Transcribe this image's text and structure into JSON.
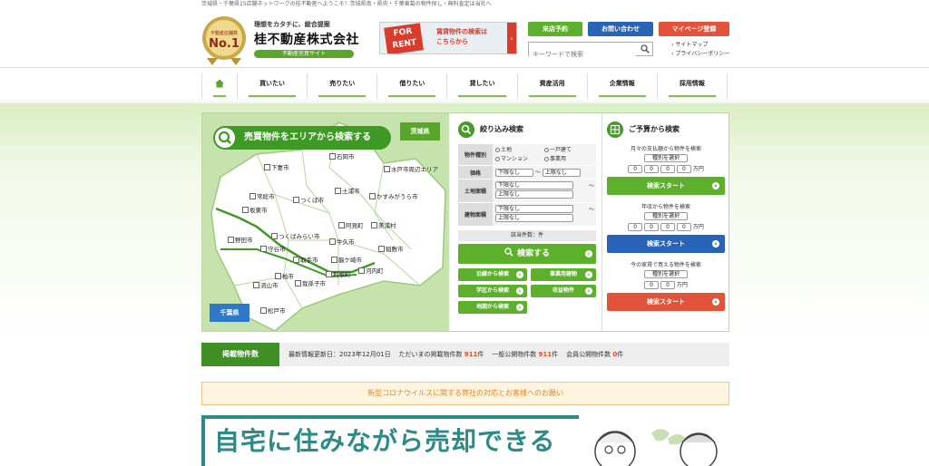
{
  "top_strip": "茨城県・千葉県15店舗ネットワークの桂不動産へようこそ！茨城県南・県央・千葉東葛の物件探し・無料査定は当社へ",
  "logo": {
    "tagline": "理想をカタチに、総合提案",
    "name": "桂不動産株式会社",
    "site": "不動産売買サイト",
    "badge": "No.1"
  },
  "rent_banner": {
    "sign": "FOR RENT",
    "line1": "賃貸物件の検索は",
    "line2": "こちらから"
  },
  "header_buttons": {
    "visit": "来店予約",
    "contact": "お問い合わせ",
    "mypage": "マイページ登録"
  },
  "search": {
    "placeholder": "キーワードで検索"
  },
  "header_links": {
    "sitemap": "サイトマップ",
    "privacy": "プライバシーポリシー"
  },
  "nav": [
    "買いたい",
    "売りたい",
    "借りたい",
    "貸したい",
    "資産活用",
    "企業情報",
    "採用情報"
  ],
  "map": {
    "title": "売買物件をエリアから検索する",
    "pref_ibaraki": "茨城県",
    "pref_chiba": "千葉県",
    "cities": [
      "石岡市",
      "下妻市",
      "水戸市周辺エリア",
      "常総市",
      "つくば市",
      "土浦市",
      "かすみがうら市",
      "坂東市",
      "阿見町",
      "美浦村",
      "野田市",
      "つくばみらい市",
      "牛久市",
      "稲敷市",
      "守谷市",
      "取手市",
      "龍ケ崎市",
      "河内町",
      "柏市",
      "利根町",
      "流山市",
      "我孫子市",
      "松戸市"
    ]
  },
  "filter": {
    "title": "絞り込み検索",
    "type_label": "物件種別",
    "types": [
      "土地",
      "一戸建て",
      "マンション",
      "事業用"
    ],
    "price_label": "価格",
    "land_label": "土地面積",
    "building_label": "建物面積",
    "lower": "下限なし",
    "upper": "上限なし",
    "tilde": "～",
    "count_label": "該当件数：件",
    "search_btn": "検索する",
    "sub_buttons": [
      "沿線から検索",
      "事業用建物",
      "学区から検索",
      "収益物件",
      "地図から検索"
    ]
  },
  "budget": {
    "title": "ご予算から検索",
    "monthly_text": "月々の支払額から物件を検索",
    "income_text": "年収から物件を検索",
    "rent_text": "今の家賃で買える物件を検索",
    "select_type": "種別を選択",
    "zero": "0",
    "unit": "万円",
    "start": "検索スタート",
    "colors": {
      "green": "#5cb02b",
      "blue": "#2763b6",
      "red": "#e2533b"
    }
  },
  "stats": {
    "label": "掲載物件数",
    "updated": "最新情報更新日：2023年12月01日",
    "total_label": "ただいまの掲載物件数",
    "total": "911",
    "general_label": "一般公開物件数",
    "general": "911",
    "member_label": "会員公開物件数",
    "member": "0",
    "unit": "件"
  },
  "covid_notice": "新型コロナウイルスに関する弊社の対応とお客様へのお願い",
  "sell_banner": "自宅に住みながら売却できる"
}
